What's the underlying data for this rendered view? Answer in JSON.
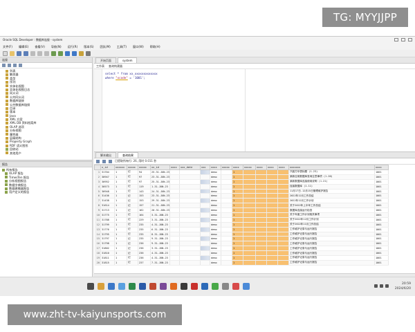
{
  "watermark": {
    "tg_text": "TG: MYYJJPP",
    "url_text": "www.zht-tv-kaiyunsports.com"
  },
  "window": {
    "title": "Oracle SQL Developer : 数据库连接 - system"
  },
  "menu": [
    "文件(F)",
    "编辑(E)",
    "查看(V)",
    "导航(N)",
    "运行(R)",
    "版本(S)",
    "团队(M)",
    "工具(T)",
    "窗口(W)",
    "帮助(H)"
  ],
  "left_pane": {
    "title": "连接",
    "tree_top": [
      "列表",
      "触发器",
      "类型",
      "序列",
      "实体化视图",
      "实体化视图日志",
      "同义词",
      "公共同义词",
      "数据库链接",
      "公共数据库链接",
      "目录",
      "版本",
      "Java",
      "XML 方案",
      "XML DB 资料档案库",
      "OLAP 选项",
      "分析视图",
      "属性维",
      "层级结构",
      "Property Graph",
      "RDF 语义图形",
      "回收站",
      "其他用户"
    ],
    "bottom_title": "报告",
    "tree_bottom": [
      "所有报告",
      "OLAP 报告",
      "TimesTen 报告",
      "分析视图报告",
      "数据字典报告",
      "数据建模器报告",
      "用户定义的报告"
    ]
  },
  "editor": {
    "tabs": [
      "开始页面",
      "system"
    ],
    "sub_tabs": [
      "工作表",
      "查询构建器"
    ],
    "code_line1": "select * from xx_xxxxxxxxxxxxx",
    "code_line2_prefix": "where ",
    "code_line2_hl": "\"xcode\"",
    "code_line2_suffix": " = '1001';"
  },
  "results": {
    "tabs": [
      "脚本输出",
      "查询结果"
    ],
    "fetch_info": "已提取所有行: 26, 用时 0.011 秒",
    "columns": [
      "",
      "x_id",
      "xxxxxx",
      "xxxxx",
      "xxxxx",
      "xx_id",
      "xxxx",
      "xxx_date",
      "xxx",
      "xxxx",
      "xxxxx",
      "xxxx",
      "xxxxx",
      "xxxx",
      "xxxx",
      "xxxx",
      "xxxxxxx",
      "xxxx"
    ],
    "rows": [
      [
        "1",
        "31704",
        "1",
        "记",
        "94",
        "25.31-JUN-23",
        "",
        "",
        "",
        "demo",
        "",
        "1",
        "",
        "",
        "",
        "",
        "只能打印表标题 (1.23)",
        "1001"
      ],
      [
        "2",
        "30947",
        "1",
        "记",
        "97",
        "23.31-JUN-23",
        "",
        "",
        "",
        "demo",
        "",
        "1",
        "",
        "",
        "",
        "",
        "某款应用数据库查询注意事项 (1.20)",
        "1001"
      ],
      [
        "3",
        "30952",
        "1",
        "记",
        "97",
        "25.31-JUN-23",
        "",
        "",
        "",
        "demo",
        "",
        "1",
        "",
        "",
        "",
        "",
        "某款数据库连接使用说明 (1.21)",
        "1001"
      ],
      [
        "4",
        "30573",
        "1",
        "记",
        "119",
        "1.31-JUN-23",
        "",
        "",
        "",
        "demo",
        "",
        "1",
        "",
        "",
        "",
        "",
        "连接数据库 (1.11)",
        "1001"
      ],
      [
        "5",
        "30948",
        "1",
        "记",
        "143",
        "24.31-JUN-23",
        "",
        "",
        "",
        "demo",
        "",
        "1",
        "",
        "",
        "",
        "",
        "11月17日-12月15日管理维护报告",
        "1001"
      ],
      [
        "6",
        "31436",
        "1",
        "记",
        "153",
        "23.31-JUN-23",
        "",
        "",
        "",
        "demo",
        "",
        "1",
        "",
        "",
        "",
        "",
        "2022年12月工作总结",
        "1001"
      ],
      [
        "7",
        "31438",
        "1",
        "记",
        "153",
        "29.31-JUN-23",
        "",
        "",
        "",
        "demo",
        "",
        "1",
        "",
        "",
        "",
        "",
        "2022年12月工作计划",
        "1001"
      ],
      [
        "8",
        "31614",
        "1",
        "记",
        "157",
        "21.31-JUN-23",
        "",
        "",
        "",
        "demo",
        "",
        "1",
        "",
        "",
        "",
        "",
        "关于2022年上半年工作总结",
        "1001"
      ],
      [
        "9",
        "31713",
        "1",
        "记",
        "162",
        "20.31-JUN-23",
        "",
        "",
        "",
        "demo",
        "",
        "1",
        "",
        "",
        "",
        "",
        "数据库连接运行检查",
        "1001"
      ],
      [
        "10",
        "31775",
        "1",
        "记",
        "164",
        "3.31-JUN-23",
        "",
        "",
        "",
        "demo",
        "",
        "1",
        "",
        "",
        "",
        "",
        "关于年度工作计划相关事项",
        "1001"
      ],
      [
        "11",
        "31788",
        "1",
        "记",
        "229",
        "3.31-JUN-23",
        "",
        "",
        "",
        "demo",
        "",
        "1",
        "",
        "",
        "",
        "",
        "关于2022年12月工作计划",
        "1001"
      ],
      [
        "12",
        "31799",
        "1",
        "记",
        "235",
        "4.31-JUN-23",
        "",
        "",
        "",
        "demo",
        "",
        "1",
        "",
        "",
        "",
        "",
        "关于2022年11月工作总结",
        "1001"
      ],
      [
        "13",
        "31776",
        "1",
        "记",
        "235",
        "6.31-JUN-23",
        "",
        "",
        "",
        "demo",
        "",
        "1",
        "",
        "",
        "",
        "",
        "工作维护记录与运行报告",
        "1001"
      ],
      [
        "14",
        "31795",
        "1",
        "记",
        "235",
        "8.31-JUN-23",
        "",
        "",
        "",
        "demo",
        "",
        "1",
        "",
        "",
        "",
        "",
        "工作维护记录与运行报告",
        "1001"
      ],
      [
        "15",
        "31797",
        "1",
        "记",
        "235",
        "9.31-JUN-23",
        "",
        "",
        "",
        "demo",
        "",
        "1",
        "",
        "",
        "",
        "",
        "工作维护记录与运行报告",
        "1001"
      ],
      [
        "16",
        "31798",
        "1",
        "记",
        "236",
        "9.31-JUN-23",
        "",
        "",
        "",
        "demo",
        "",
        "1",
        "",
        "",
        "",
        "",
        "工作维护记录与运行报告",
        "1001"
      ],
      [
        "17",
        "31802",
        "1",
        "记",
        "236",
        "3.31-JUN-23",
        "",
        "",
        "",
        "demo",
        "",
        "1",
        "",
        "",
        "",
        "",
        "工作维护记录与运行报告",
        "1001"
      ],
      [
        "18",
        "31810",
        "1",
        "记",
        "236",
        "4.31-JUN-23",
        "",
        "",
        "",
        "demo",
        "",
        "1",
        "",
        "",
        "",
        "",
        "工作维护记录与运行报告",
        "1001"
      ],
      [
        "19",
        "31811",
        "1",
        "记",
        "236",
        "4.31-JUN-23",
        "",
        "",
        "",
        "demo",
        "",
        "1",
        "",
        "",
        "",
        "",
        "工作维护记录与运行报告",
        "1001"
      ],
      [
        "20",
        "31815",
        "1",
        "记",
        "237",
        "7.31-JUN-23",
        "",
        "",
        "",
        "demo",
        "",
        "1",
        "",
        "",
        "",
        "",
        "工作维护记录与运行报告",
        "1001"
      ]
    ]
  },
  "taskbar": {
    "time": "20:59",
    "date": "2024/6/20"
  },
  "colors": {
    "highlight_cell": "#f8c070",
    "blurred_cell": "#c6d2e4",
    "watermark_bg": "#8f8f8f"
  }
}
